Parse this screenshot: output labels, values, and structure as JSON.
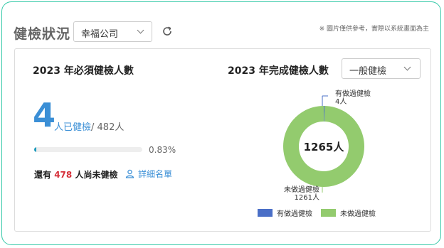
{
  "header": {
    "title": "健檢狀況",
    "company_select": {
      "value": "幸福公司"
    },
    "note": "※ 圖片僅供參考，實際以系統畫面為主"
  },
  "required": {
    "title": "2023 年必須健檢人數",
    "count": "4",
    "done_label": "人已健檢",
    "total": "/ 482人",
    "progress_fraction": 0.0083,
    "percent": "0.83%",
    "remaining_prefix": "還有",
    "remaining_count": "478",
    "remaining_suffix": "人尚未健檢",
    "detail_link": "詳細名單"
  },
  "completed": {
    "title": "2023 年完成健檢人數",
    "type_select": {
      "value": "一般健檢"
    }
  },
  "chart_data": {
    "type": "pie",
    "center_label": "1265人",
    "categories": [
      "有做過健檢",
      "未做過健檢"
    ],
    "values": [
      4,
      1261
    ],
    "value_labels": [
      "4人",
      "1261人"
    ],
    "colors": [
      "#4a6fc7",
      "#93cb6e"
    ],
    "legend_position": "bottom"
  },
  "colors": {
    "accent": "#3b8fd6",
    "frame": "#35c9a8",
    "alert": "#d6303a"
  }
}
